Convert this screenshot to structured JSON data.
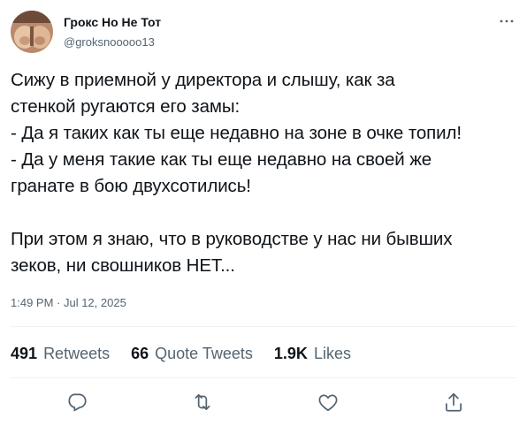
{
  "author": {
    "display_name": "Грокс Но Не Тот",
    "handle": "@groksnooooo13",
    "avatar_icon": "avatar-photo"
  },
  "tweet": {
    "text": "Сижу в приемной у директора и слышу, как за\nстенкой ругаются его замы:\n- Да я таких как ты еще недавно на зоне в очке топил!\n- Да у меня такие как ты еще недавно на своей же\nгранате в бою двухсотились!\n\nПри этом я знаю, что в руководстве у нас ни бывших\nзеков, ни свошников НЕТ...",
    "timestamp": "1:49 PM · Jul 12, 2025"
  },
  "stats": {
    "retweets_count": "491",
    "retweets_label": "Retweets",
    "quotes_count": "66",
    "quotes_label": "Quote Tweets",
    "likes_count": "1.9K",
    "likes_label": "Likes"
  },
  "icons": {
    "more": "more-icon",
    "reply": "reply-icon",
    "retweet": "retweet-icon",
    "like": "like-icon",
    "share": "share-icon"
  },
  "colors": {
    "text_primary": "#0f1419",
    "text_secondary": "#536471",
    "divider": "#eff3f4",
    "icon": "#536471"
  }
}
